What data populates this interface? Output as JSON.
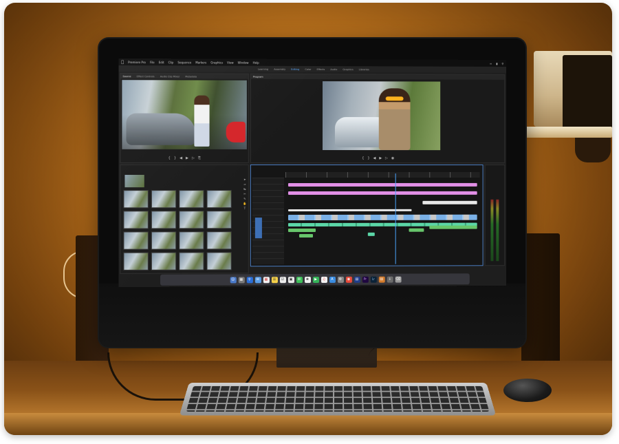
{
  "scene": {
    "colors": {
      "wall": "#c07a22",
      "desk": "#8a5218",
      "bezel": "#0b0b0b",
      "accent_blue": "#4aa4ff",
      "clip_pink": "#e18fe6",
      "clip_teal": "#5bd6a7"
    }
  },
  "app": {
    "menubar": {
      "apple_icon": "apple-icon",
      "items": [
        "Premiere Pro",
        "File",
        "Edit",
        "Clip",
        "Sequence",
        "Markers",
        "Graphics",
        "View",
        "Window",
        "Help"
      ]
    },
    "workspaces": [
      "Learning",
      "Assembly",
      "Editing",
      "Color",
      "Effects",
      "Audio",
      "Graphics",
      "Libraries"
    ],
    "active_workspace": "Editing",
    "source_monitor": {
      "tabs": [
        "Source",
        "Effect Controls",
        "Audio Clip Mixer",
        "Metadata"
      ]
    },
    "program_monitor": {
      "tabs": [
        "Program"
      ]
    },
    "dock": {
      "pr_label": "Pr",
      "lr_label": "Lr"
    }
  }
}
